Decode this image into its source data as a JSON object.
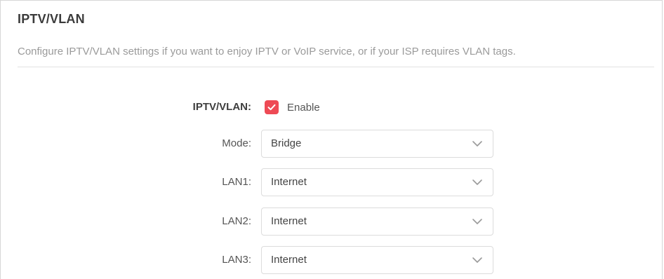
{
  "section": {
    "title": "IPTV/VLAN",
    "description": "Configure IPTV/VLAN settings if you want to enjoy IPTV or VoIP service, or if your ISP requires VLAN tags."
  },
  "iptv_vlan": {
    "label": "IPTV/VLAN:",
    "enable_label": "Enable",
    "enabled": true
  },
  "fields": [
    {
      "label": "Mode:",
      "value": "Bridge"
    },
    {
      "label": "LAN1:",
      "value": "Internet"
    },
    {
      "label": "LAN2:",
      "value": "Internet"
    },
    {
      "label": "LAN3:",
      "value": "Internet"
    }
  ],
  "colors": {
    "accent": "#ee4a55",
    "title": "#3b3b3b",
    "description": "#9a9a9a",
    "label": "#555555",
    "border": "#dcdcdc"
  },
  "icons": {
    "checkbox": "checkmark-icon",
    "dropdown": "chevron-down-icon"
  }
}
